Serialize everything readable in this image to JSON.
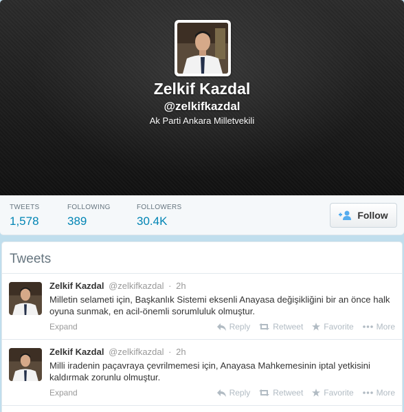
{
  "profile": {
    "name": "Zelkif Kazdal",
    "handle": "@zelkifkazdal",
    "bio": "Ak Parti Ankara Milletvekili"
  },
  "stats": [
    {
      "label": "TWEETS",
      "value": "1,578"
    },
    {
      "label": "FOLLOWING",
      "value": "389"
    },
    {
      "label": "FOLLOWERS",
      "value": "30.4K"
    }
  ],
  "follow_button": {
    "label": "Follow",
    "icon": "add-user-icon"
  },
  "tweets_panel": {
    "title": "Tweets",
    "items": [
      {
        "name": "Zelkif Kazdal",
        "handle": "@zelkifkazdal",
        "dot": "·",
        "time": "2h",
        "text": "Milletin selameti için, Başkanlık Sistemi eksenli Anayasa değişikliğini bir an önce halk oyuna sunmak, en acil-önemli sorumluluk olmuştur.",
        "expand": "Expand",
        "actions": {
          "reply": "Reply",
          "retweet": "Retweet",
          "favorite": "Favorite",
          "more": "More"
        }
      },
      {
        "name": "Zelkif Kazdal",
        "handle": "@zelkifkazdal",
        "dot": "·",
        "time": "2h",
        "text": "Milli iradenin paçavraya çevrilmemesi için, Anayasa Mahkemesinin iptal yetkisini kaldırmak zorunlu olmuştur.",
        "expand": "Expand",
        "actions": {
          "reply": "Reply",
          "retweet": "Retweet",
          "favorite": "Favorite",
          "more": "More"
        }
      }
    ]
  },
  "colors": {
    "link": "#0084b4",
    "header_bg": "#1c1c1c",
    "muted": "#999999"
  }
}
